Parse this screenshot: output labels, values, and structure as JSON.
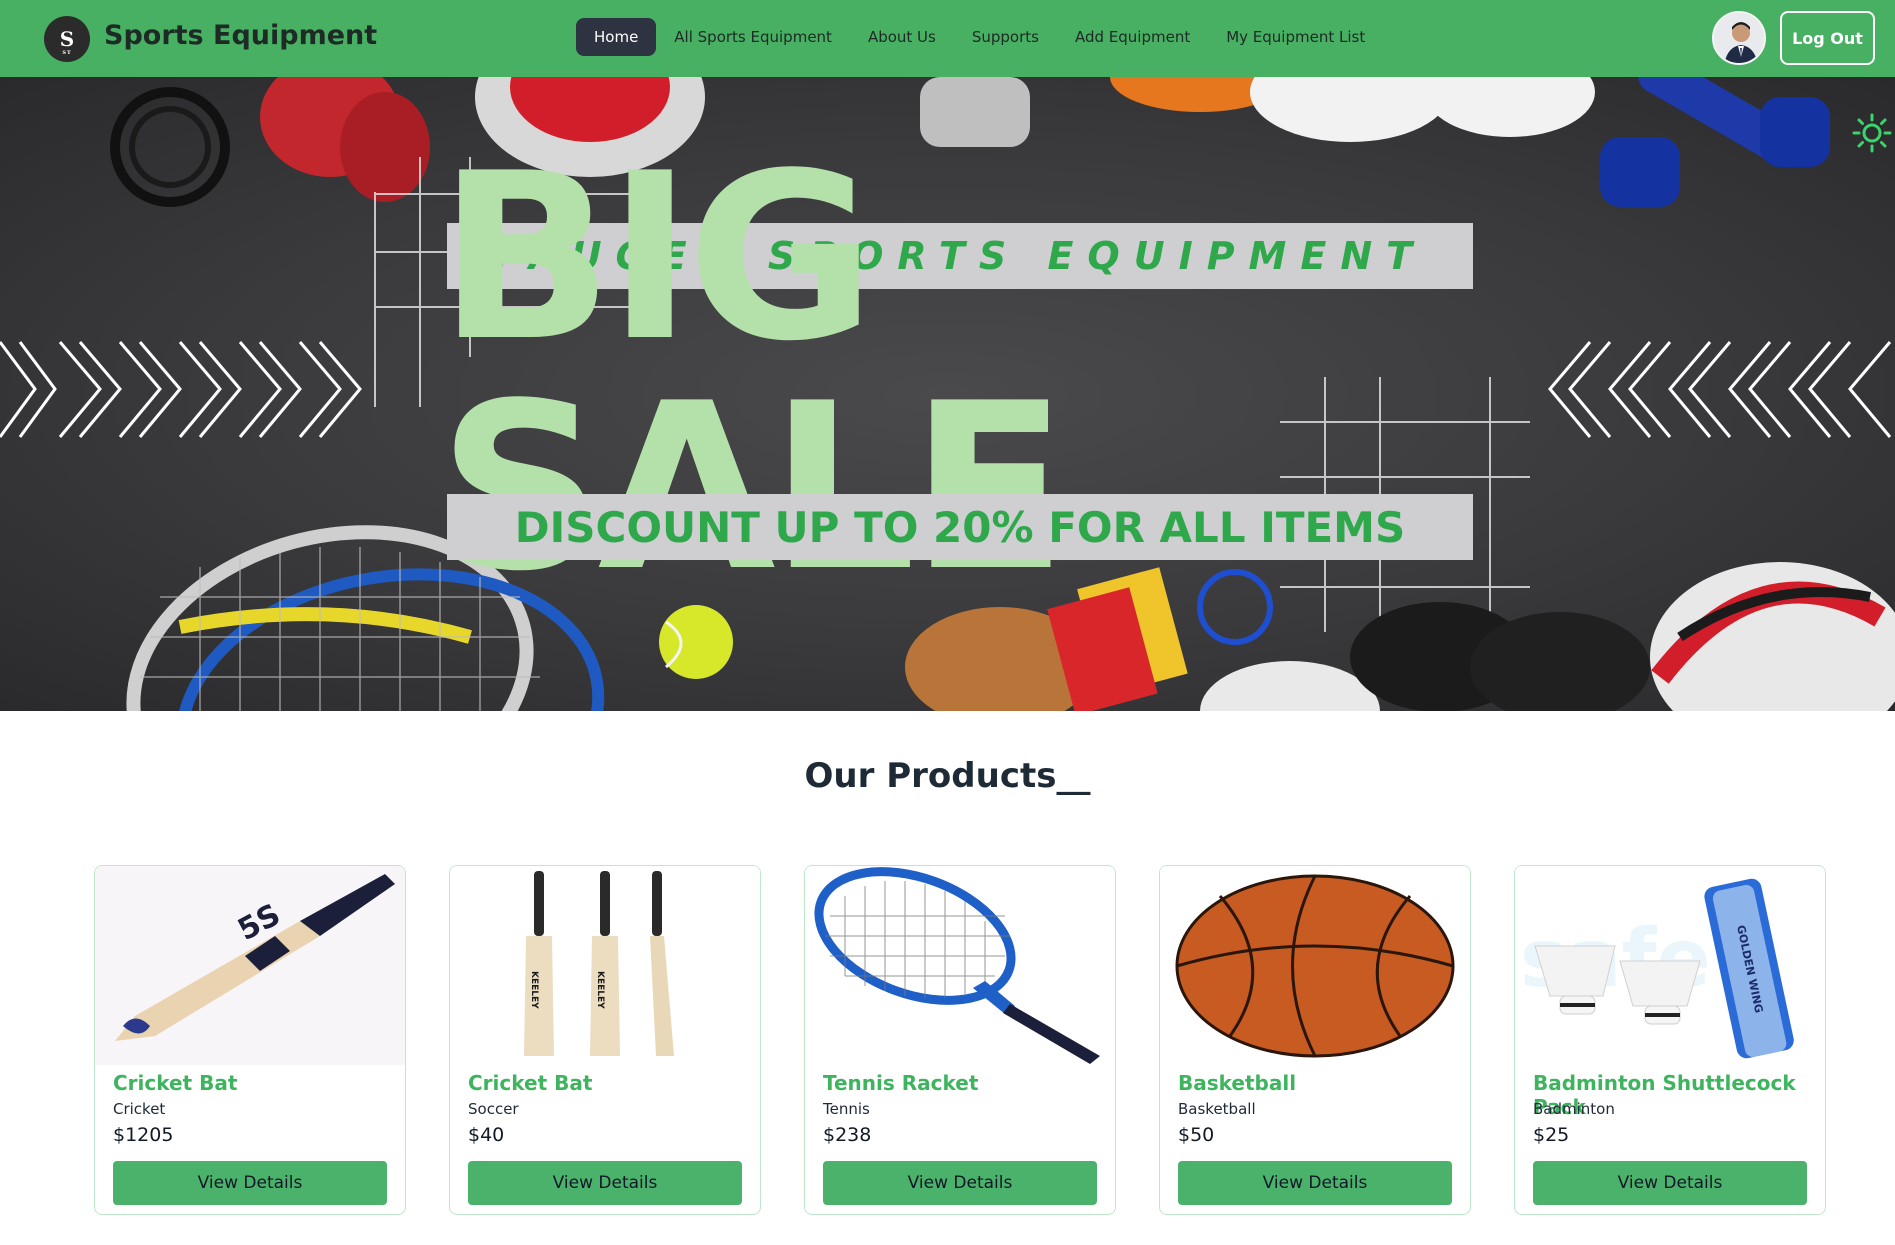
{
  "navbar": {
    "brand": "Sports Equipment",
    "logo_letter": "S",
    "logo_sub": "ST",
    "links": [
      {
        "label": "Home",
        "active": true
      },
      {
        "label": "All Sports Equipment",
        "active": false
      },
      {
        "label": "About Us",
        "active": false
      },
      {
        "label": "Supports",
        "active": false
      },
      {
        "label": "Add Equipment",
        "active": false
      },
      {
        "label": "My Equipment List",
        "active": false
      }
    ],
    "logout_label": "Log Out",
    "accent_color": "#47b063"
  },
  "hero": {
    "tagline": "FAUGET SPORTS EQUIPMENT",
    "headline": "BIG SALE",
    "subline": "DISCOUNT UP TO 20% FOR ALL ITEMS",
    "theme_icon": "sun-icon"
  },
  "products": {
    "title": "Our Products__",
    "items": [
      {
        "name": "Cricket Bat",
        "category": "Cricket",
        "price": "$1205",
        "button": "View Details",
        "image": "cricket-bat-single"
      },
      {
        "name": "Cricket Bat",
        "category": "Soccer",
        "price": "$40",
        "button": "View Details",
        "image": "cricket-bats-three"
      },
      {
        "name": "Tennis Racket",
        "category": "Tennis",
        "price": "$238",
        "button": "View Details",
        "image": "tennis-racket"
      },
      {
        "name": "Basketball",
        "category": "Basketball",
        "price": "$50",
        "button": "View Details",
        "image": "basketball"
      },
      {
        "name": "Badminton Shuttlecock Pack",
        "category": "Badminton",
        "price": "$25",
        "button": "View Details",
        "image": "shuttlecock-pack"
      }
    ]
  }
}
